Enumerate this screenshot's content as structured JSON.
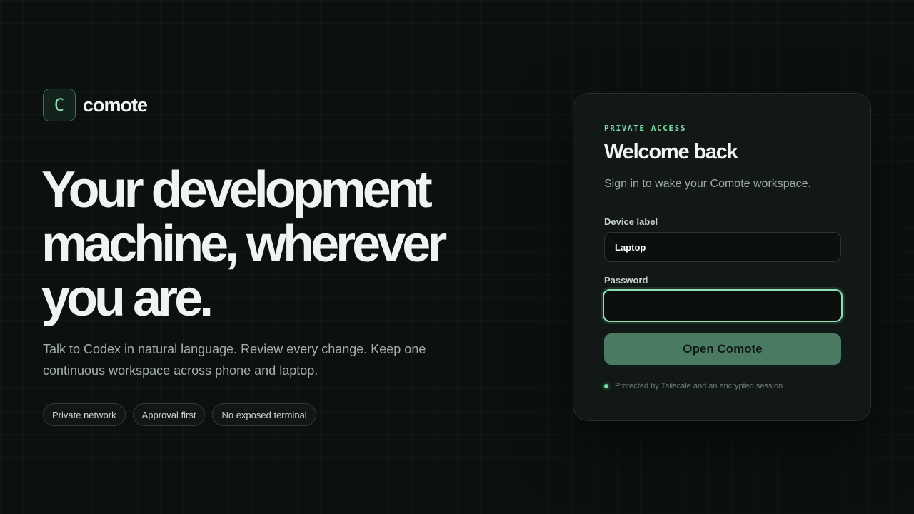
{
  "brand": {
    "logo_letter": "C",
    "name": "comote"
  },
  "hero": {
    "line1": "Your development",
    "line2": "machine, wherever",
    "line3": "you are.",
    "subtitle": "Talk to Codex in natural language. Review every change. Keep one continuous workspace across phone and laptop."
  },
  "chips": [
    {
      "label": "Private network"
    },
    {
      "label": "Approval first"
    },
    {
      "label": "No exposed terminal"
    }
  ],
  "login": {
    "eyebrow": "PRIVATE ACCESS",
    "title": "Welcome back",
    "subtitle": "Sign in to wake your Comote workspace.",
    "device_label": "Device label",
    "device_value": "Laptop",
    "password_label": "Password",
    "password_value": "",
    "submit_label": "Open Comote",
    "note": "Protected by Tailscale and an encrypted session."
  },
  "colors": {
    "background": "#0c1110",
    "accent": "#7fdcaa",
    "button": "#4a7a62",
    "card": "#111816"
  }
}
